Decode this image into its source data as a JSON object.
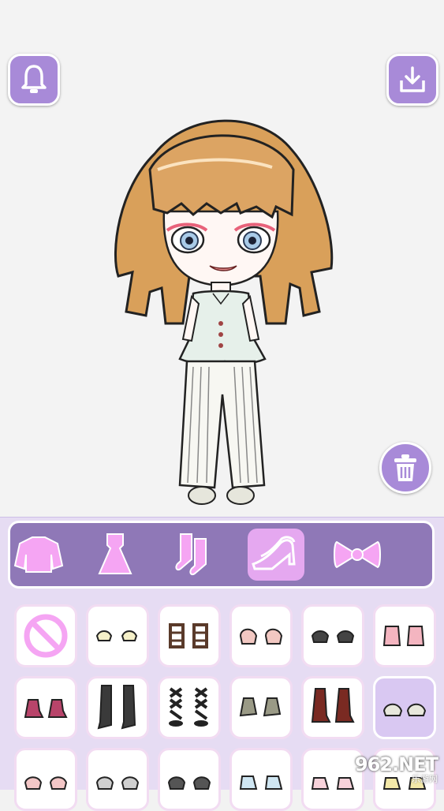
{
  "colors": {
    "accent": "#a88ad8",
    "category_bar": "#8f78b7",
    "selected_category": "#e5a8f0",
    "icon_pink": "#f5a5f3",
    "panel_bg": "#e6dcf3"
  },
  "toolbar": {
    "theme_icon": "bell-icon",
    "save_icon": "download-icon",
    "trash_icon": "trash-icon"
  },
  "categories": [
    {
      "icon": "top-icon"
    },
    {
      "icon": "dress-icon"
    },
    {
      "icon": "socks-icon"
    },
    {
      "icon": "shoes-icon",
      "selected": true
    },
    {
      "icon": "bow-icon"
    },
    {
      "icon": "accessory-icon"
    }
  ],
  "items": [
    {
      "icon": "none-icon"
    },
    {
      "icon": "flats-cream-icon"
    },
    {
      "icon": "sandals-brown-icon"
    },
    {
      "icon": "mary-jane-pink-icon"
    },
    {
      "icon": "flats-black-icon"
    },
    {
      "icon": "fluffy-boots-pink-icon"
    },
    {
      "icon": "ankle-boots-magenta-icon"
    },
    {
      "icon": "tall-boots-black-icon"
    },
    {
      "icon": "lace-up-sandals-black-icon"
    },
    {
      "icon": "sneakers-grey-icon"
    },
    {
      "icon": "combat-boots-red-icon"
    },
    {
      "icon": "sneakers-white-icon",
      "selected": true
    },
    {
      "icon": "slip-ons-pink-icon"
    },
    {
      "icon": "checkered-shoes-icon"
    },
    {
      "icon": "loafers-dark-icon"
    },
    {
      "icon": "sneakers-blue-icon"
    },
    {
      "icon": "ribbon-shoes-icon"
    },
    {
      "icon": "sneakers-yellow-icon"
    }
  ],
  "watermark": {
    "top": "962.NET",
    "bottom": "乐游网"
  }
}
